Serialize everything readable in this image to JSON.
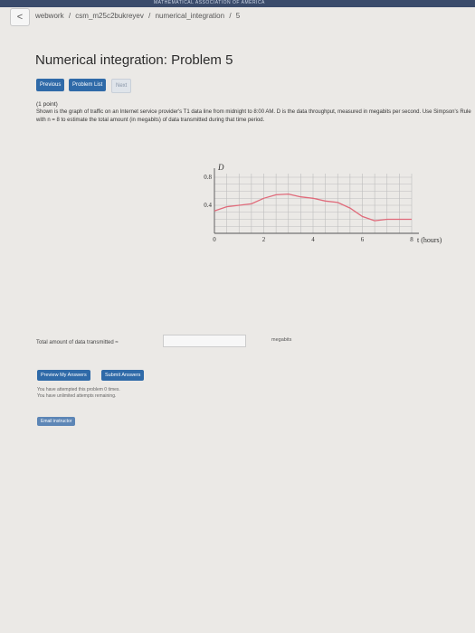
{
  "header": {
    "banner_text": "MATHEMATICAL ASSOCIATION OF AMERICA",
    "back_label": "<",
    "breadcrumb": [
      "webwork",
      "/",
      "csm_m25c2bukreyev",
      "/",
      "numerical_integration",
      "/",
      "5"
    ]
  },
  "page": {
    "title": "Numerical integration: Problem 5"
  },
  "nav": {
    "previous": "Previous",
    "problem_list": "Problem List",
    "next": "Next"
  },
  "problem": {
    "points": "(1 point)",
    "text": "Shown is the graph of traffic on an Internet service provider's T1 data line from midnight to 8:00 AM. D is the data throughput, measured in megabits per second. Use Simpson's Rule with n = 8 to estimate the total amount (in megabits) of data transmitted during that time period."
  },
  "chart_data": {
    "type": "line",
    "title": "",
    "xlabel": "t (hours)",
    "ylabel": "D",
    "xlim": [
      0,
      8
    ],
    "ylim": [
      0,
      0.8
    ],
    "xticks": [
      "0",
      "2",
      "4",
      "6",
      "8"
    ],
    "yticks": [
      "0.4",
      "0.8"
    ],
    "x": [
      0,
      0.5,
      1,
      1.5,
      2,
      2.5,
      3,
      3.5,
      4,
      4.5,
      5,
      5.5,
      6,
      6.5,
      7,
      7.5,
      8
    ],
    "y": [
      0.32,
      0.38,
      0.4,
      0.42,
      0.5,
      0.55,
      0.56,
      0.52,
      0.5,
      0.46,
      0.44,
      0.36,
      0.24,
      0.18,
      0.2,
      0.2,
      0.2
    ],
    "line_color": "#e06a7a",
    "grid": true
  },
  "answer": {
    "label": "Total amount of data transmitted ≈",
    "value": "",
    "unit": "megabits"
  },
  "actions": {
    "preview": "Preview My Answers",
    "submit": "Submit Answers"
  },
  "status": {
    "attempts": "You have attempted this problem 0 times.",
    "remaining": "You have unlimited attempts remaining."
  },
  "footer": {
    "email": "Email instructor"
  }
}
